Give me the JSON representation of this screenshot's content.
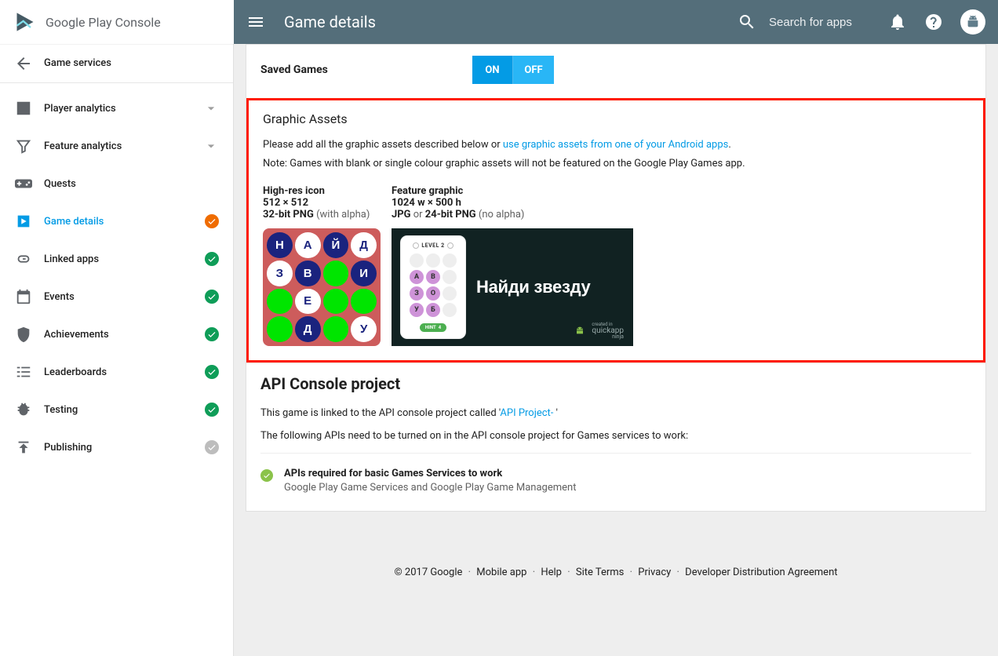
{
  "brand": "Google Play Console",
  "header": {
    "title": "Game details",
    "search_placeholder": "Search for apps"
  },
  "sidebar": {
    "back": "Game services",
    "items": [
      {
        "label": "Player analytics",
        "expandable": true
      },
      {
        "label": "Feature analytics",
        "expandable": true
      },
      {
        "label": "Quests"
      },
      {
        "label": "Game details",
        "active": true,
        "status": "orange"
      },
      {
        "label": "Linked apps",
        "status": "green"
      },
      {
        "label": "Events",
        "status": "green"
      },
      {
        "label": "Achievements",
        "status": "green"
      },
      {
        "label": "Leaderboards",
        "status": "green"
      },
      {
        "label": "Testing",
        "status": "green"
      },
      {
        "label": "Publishing",
        "status": "grey"
      }
    ]
  },
  "saved_games": {
    "label": "Saved Games",
    "on": "ON",
    "off": "OFF"
  },
  "graphic_assets": {
    "title": "Graphic Assets",
    "desc_prefix": "Please add all the graphic assets described below or ",
    "desc_link": "use graphic assets from one of your Android apps",
    "desc_period": ".",
    "note": "Note: Games with blank or single colour graphic assets will not be featured on the Google Play Games app.",
    "icon": {
      "title": "High-res icon",
      "dim": "512 × 512",
      "fmt_bold": "32-bit PNG",
      "fmt_grey": " (with alpha)"
    },
    "feature": {
      "title": "Feature graphic",
      "dim": "1024 w × 500 h",
      "fmt_bold1": "JPG",
      "fmt_or": " or ",
      "fmt_bold2": "24-bit PNG",
      "fmt_grey": " (no alpha)"
    },
    "preview": {
      "grid": [
        {
          "t": "Н",
          "c": "nv"
        },
        {
          "t": "А",
          "c": "wh"
        },
        {
          "t": "Й",
          "c": "nv"
        },
        {
          "t": "Д",
          "c": "wh"
        },
        {
          "t": "З",
          "c": "wh"
        },
        {
          "t": "В",
          "c": "nv"
        },
        {
          "t": "",
          "c": "gr"
        },
        {
          "t": "И",
          "c": "nv"
        },
        {
          "t": "",
          "c": "gr"
        },
        {
          "t": "Е",
          "c": "wh"
        },
        {
          "t": "",
          "c": "gr"
        },
        {
          "t": "",
          "c": "gr"
        },
        {
          "t": "",
          "c": "gr"
        },
        {
          "t": "Д",
          "c": "nv"
        },
        {
          "t": "",
          "c": "gr"
        },
        {
          "t": "У",
          "c": "wh"
        }
      ],
      "phone_level": "LEVEL 2",
      "phone_grid": [
        {
          "t": "",
          "c": "e"
        },
        {
          "t": "",
          "c": "e"
        },
        {
          "t": "",
          "c": "e"
        },
        {
          "t": "А",
          "c": "p"
        },
        {
          "t": "В",
          "c": "p"
        },
        {
          "t": "",
          "c": "e"
        },
        {
          "t": "З",
          "c": "p"
        },
        {
          "t": "О",
          "c": "p"
        },
        {
          "t": "",
          "c": "e"
        },
        {
          "t": "У",
          "c": "p"
        },
        {
          "t": "Б",
          "c": "p"
        },
        {
          "t": "",
          "c": "e"
        }
      ],
      "hint": "HINT",
      "hint_count": "4",
      "headline": "Найди звезду",
      "credit_prefix": "created in",
      "credit": "quickapp",
      "credit_sub": "ninja"
    }
  },
  "api": {
    "title": "API Console project",
    "linked_prefix": "This game is linked to the API console project called '",
    "linked_link": "API Project- ",
    "linked_suffix": "'",
    "following": "The following APIs need to be turned on in the API console project for Games services to work:",
    "item_title": "APIs required for basic Games Services to work",
    "item_sub": "Google Play Game Services and Google Play Game Management"
  },
  "footer": {
    "copyright": "© 2017 Google",
    "links": [
      "Mobile app",
      "Help",
      "Site Terms",
      "Privacy",
      "Developer Distribution Agreement"
    ]
  }
}
